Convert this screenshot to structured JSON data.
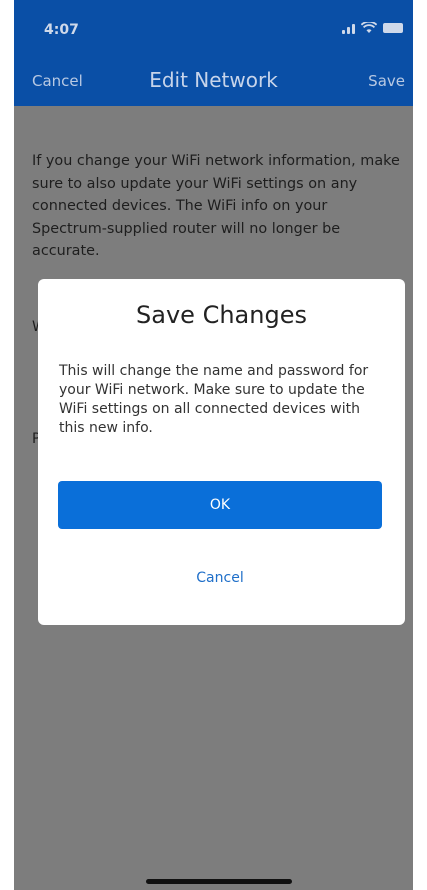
{
  "status_bar": {
    "time": "4:07"
  },
  "nav": {
    "cancel_label": "Cancel",
    "title": "Edit Network",
    "save_label": "Save"
  },
  "content": {
    "info_text": "If you change your WiFi network information, make sure to also update your WiFi settings on any connected devices. The WiFi info on your Spectrum-supplied router will no longer be accurate.",
    "field_label_1_fragment": "W",
    "field_label_2_fragment": "P"
  },
  "dialog": {
    "title": "Save Changes",
    "message": "This will change the name and password for your WiFi network. Make sure to update the WiFi settings on all connected devices with this new info.",
    "ok_label": "OK",
    "cancel_label": "Cancel"
  },
  "icons": {
    "signal": "cellular-signal-icon",
    "wifi": "wifi-icon",
    "battery": "battery-icon"
  },
  "colors": {
    "header_blue": "#0a4fa6",
    "primary_button": "#0a6fd9",
    "link_blue": "#1f6fc9",
    "overlay_gray": "#7d7d7d"
  }
}
